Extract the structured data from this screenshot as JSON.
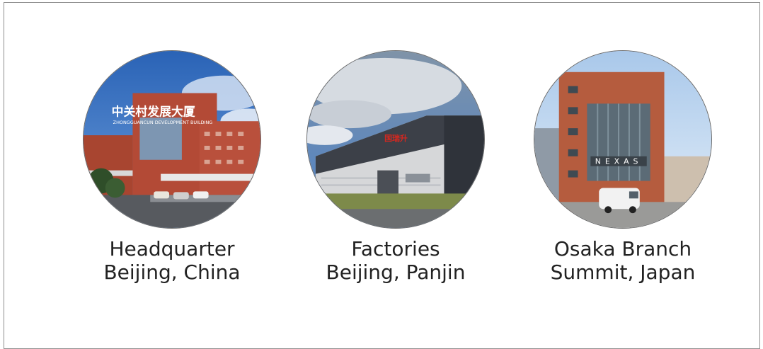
{
  "locations": [
    {
      "title": "Headquarter",
      "subtitle": "Beijing, China",
      "image_icon": "office-building-photo",
      "sign_cn": "中关村发展大厦",
      "sign_en": "ZHONGGUANCUN DEVELOPMENT BUILDING"
    },
    {
      "title": "Factories",
      "subtitle": "Beijing, Panjin",
      "image_icon": "factory-building-photo",
      "sign_cn": "国瑞升"
    },
    {
      "title": "Osaka Branch",
      "subtitle": "Summit, Japan",
      "image_icon": "branch-building-photo",
      "sign_en": "NEXAS"
    }
  ]
}
